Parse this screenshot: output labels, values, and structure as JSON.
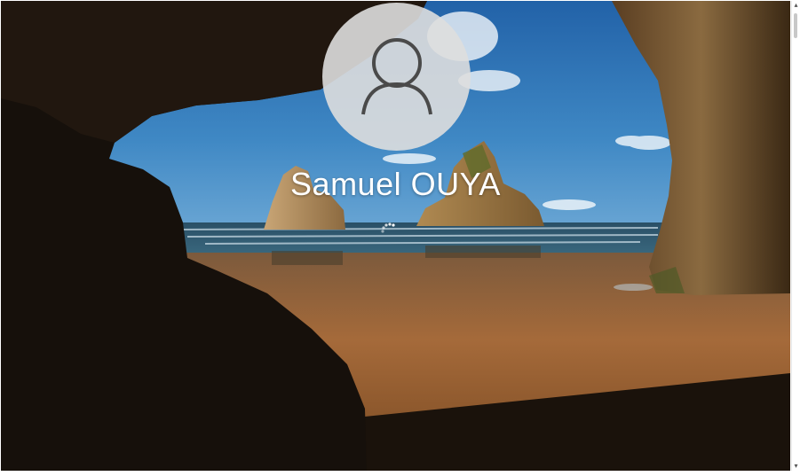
{
  "lock_screen": {
    "user": {
      "name": "Samuel OUYA",
      "avatar_icon": "user-silhouette-icon"
    },
    "status": {
      "icon": "loading-spinner-icon"
    },
    "background": {
      "description_icon": "sea-cave-wallpaper"
    }
  },
  "scrollbar": {
    "up_icon": "▴",
    "down_icon": "▾"
  },
  "colors": {
    "sky": "#3f88c4",
    "sand": "#a56a3a",
    "rock": "#2a1d12",
    "avatar": "#dedede"
  }
}
